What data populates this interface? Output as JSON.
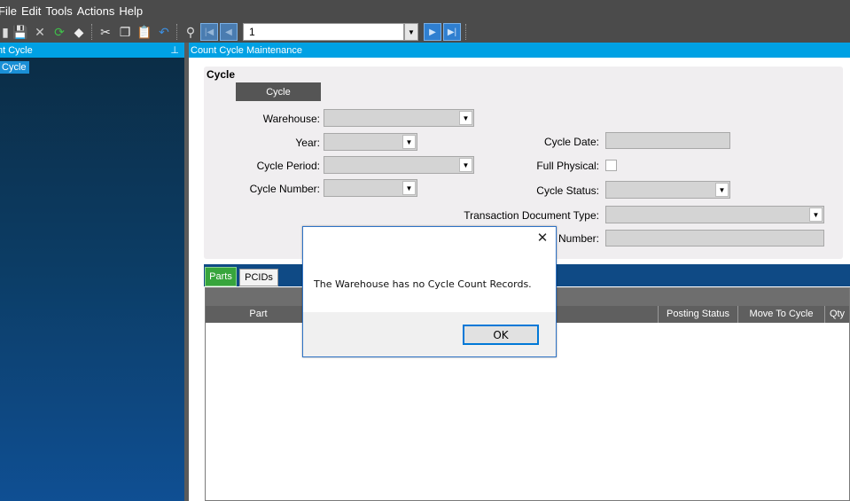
{
  "menu": {
    "items": [
      "File",
      "Edit",
      "Tools",
      "Actions",
      "Help"
    ]
  },
  "toolbar": {
    "record_value": "1",
    "icons": [
      "new-icon",
      "save-icon",
      "delete-icon",
      "refresh-icon",
      "clear-icon",
      "cut-icon",
      "copy-icon",
      "paste-icon",
      "undo-icon",
      "find-icon",
      "first-record-icon",
      "previous-record-icon",
      "next-record-icon",
      "last-record-icon"
    ]
  },
  "left_pane": {
    "title": "nt Cycle",
    "pin_glyph": "ᵖ",
    "tree_item": "Cycle"
  },
  "main": {
    "header": "Count Cycle Maintenance",
    "panel_title": "Cycle",
    "cycle_tab": "Cycle",
    "labels": {
      "warehouse": "Warehouse:",
      "year": "Year:",
      "cycle_period": "Cycle Period:",
      "cycle_number": "Cycle Number:",
      "cycle_date": "Cycle Date:",
      "full_physical": "Full Physical:",
      "cycle_status": "Cycle Status:",
      "transaction_document_type": "Transaction Document Type:",
      "number_partial": "Number:"
    },
    "tabs": [
      "Parts",
      "PCIDs"
    ],
    "grid_columns": [
      "Part",
      "Posting Status",
      "Move To Cycle",
      "Qty"
    ]
  },
  "dialog": {
    "message": "The Warehouse has no Cycle Count Records.",
    "ok_label": "OK",
    "close_glyph": "✕"
  },
  "colors": {
    "header_blue": "#00a1e4",
    "tab_active": "#37a53c",
    "dialog_border": "#2f73c5"
  }
}
